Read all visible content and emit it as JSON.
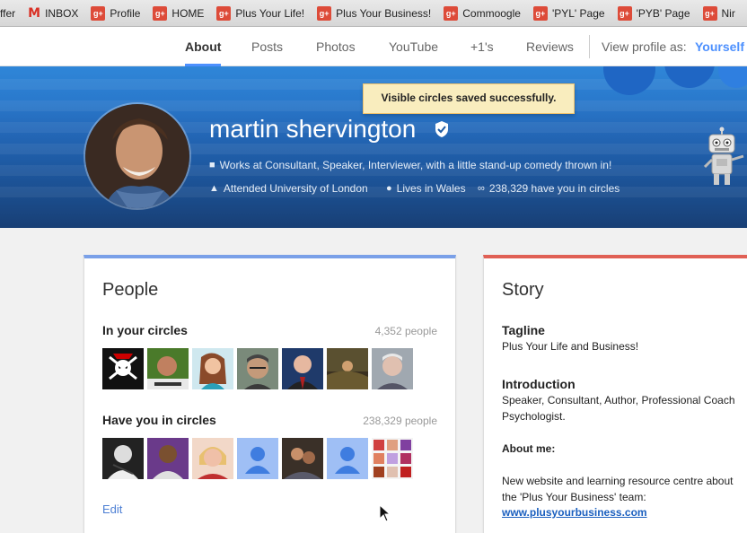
{
  "bookmarks": [
    {
      "label": "ffer",
      "icon": "none"
    },
    {
      "label": "INBOX",
      "icon": "gmail-icon"
    },
    {
      "label": "Profile",
      "icon": "gplus-icon"
    },
    {
      "label": "HOME",
      "icon": "gplus-icon"
    },
    {
      "label": "Plus Your Life!",
      "icon": "gplus-icon"
    },
    {
      "label": "Plus Your Business!",
      "icon": "gplus-icon"
    },
    {
      "label": "Commoogle",
      "icon": "gplus-icon"
    },
    {
      "label": "'PYL' Page",
      "icon": "gplus-icon"
    },
    {
      "label": "'PYB' Page",
      "icon": "gplus-icon"
    },
    {
      "label": "Nir",
      "icon": "gplus-icon"
    }
  ],
  "gplus_glyph": "g+",
  "gmail_glyph": "M",
  "tabs": [
    {
      "label": "About",
      "active": true
    },
    {
      "label": "Posts"
    },
    {
      "label": "Photos"
    },
    {
      "label": "YouTube"
    },
    {
      "label": "+1's"
    },
    {
      "label": "Reviews"
    }
  ],
  "view_as": {
    "label": "View profile as:",
    "value": "Yourself"
  },
  "toast": "Visible circles saved successfully.",
  "profile": {
    "name": "martin shervington",
    "work": "Works at Consultant, Speaker, Interviewer, with a little stand-up comedy thrown in!",
    "education": "Attended University of London",
    "location": "Lives in Wales",
    "circles": "238,329 have you in circles"
  },
  "people": {
    "title": "People",
    "in_circles": {
      "label": "In your circles",
      "count": "4,352 people"
    },
    "have_you": {
      "label": "Have you in circles",
      "count": "238,329 people"
    },
    "edit": "Edit"
  },
  "story": {
    "title": "Story",
    "tagline_label": "Tagline",
    "tagline": "Plus Your Life and Business!",
    "intro_label": "Introduction",
    "intro_line1": "Speaker, Consultant, Author, Professional Coach",
    "intro_line2": "Psychologist.",
    "about_label": "About me:",
    "about_line1": "New website and learning resource centre about",
    "about_line2": "the 'Plus Your Business' team:",
    "link": "www.plusyourbusiness.com"
  },
  "colors": {
    "accent": "#4d90fe",
    "people_bar": "#7aa0e8",
    "story_bar": "#e06055",
    "toast_bg": "#f9edbe"
  }
}
